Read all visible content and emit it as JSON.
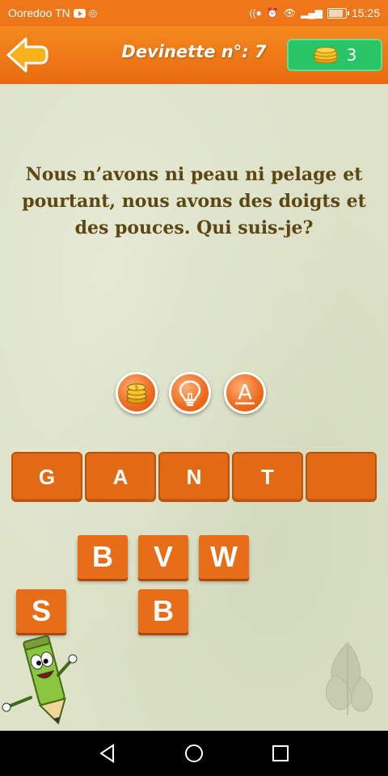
{
  "status_bar": {
    "carrier": "Ooredoo TN",
    "time": "15:25"
  },
  "header": {
    "title": "Devinette n°: 7",
    "coins": "3"
  },
  "question": "Nous n’avons ni peau ni pelage et pourtant, nous avons des doigts et des pouces. Qui suis-je?",
  "hints": [
    {
      "name": "coins-hint-icon"
    },
    {
      "name": "bulb-hint-icon"
    },
    {
      "name": "letter-hint-icon",
      "label": "A"
    }
  ],
  "answer": {
    "slots": [
      "G",
      "A",
      "N",
      "T",
      ""
    ]
  },
  "letters": [
    {
      "letter": "B"
    },
    {
      "letter": "V"
    },
    {
      "letter": "W"
    },
    {
      "letter": "S"
    },
    {
      "letter": "B"
    }
  ],
  "colors": {
    "accent": "#f0761a",
    "coin_badge": "#29c465",
    "text": "#5c4713"
  }
}
